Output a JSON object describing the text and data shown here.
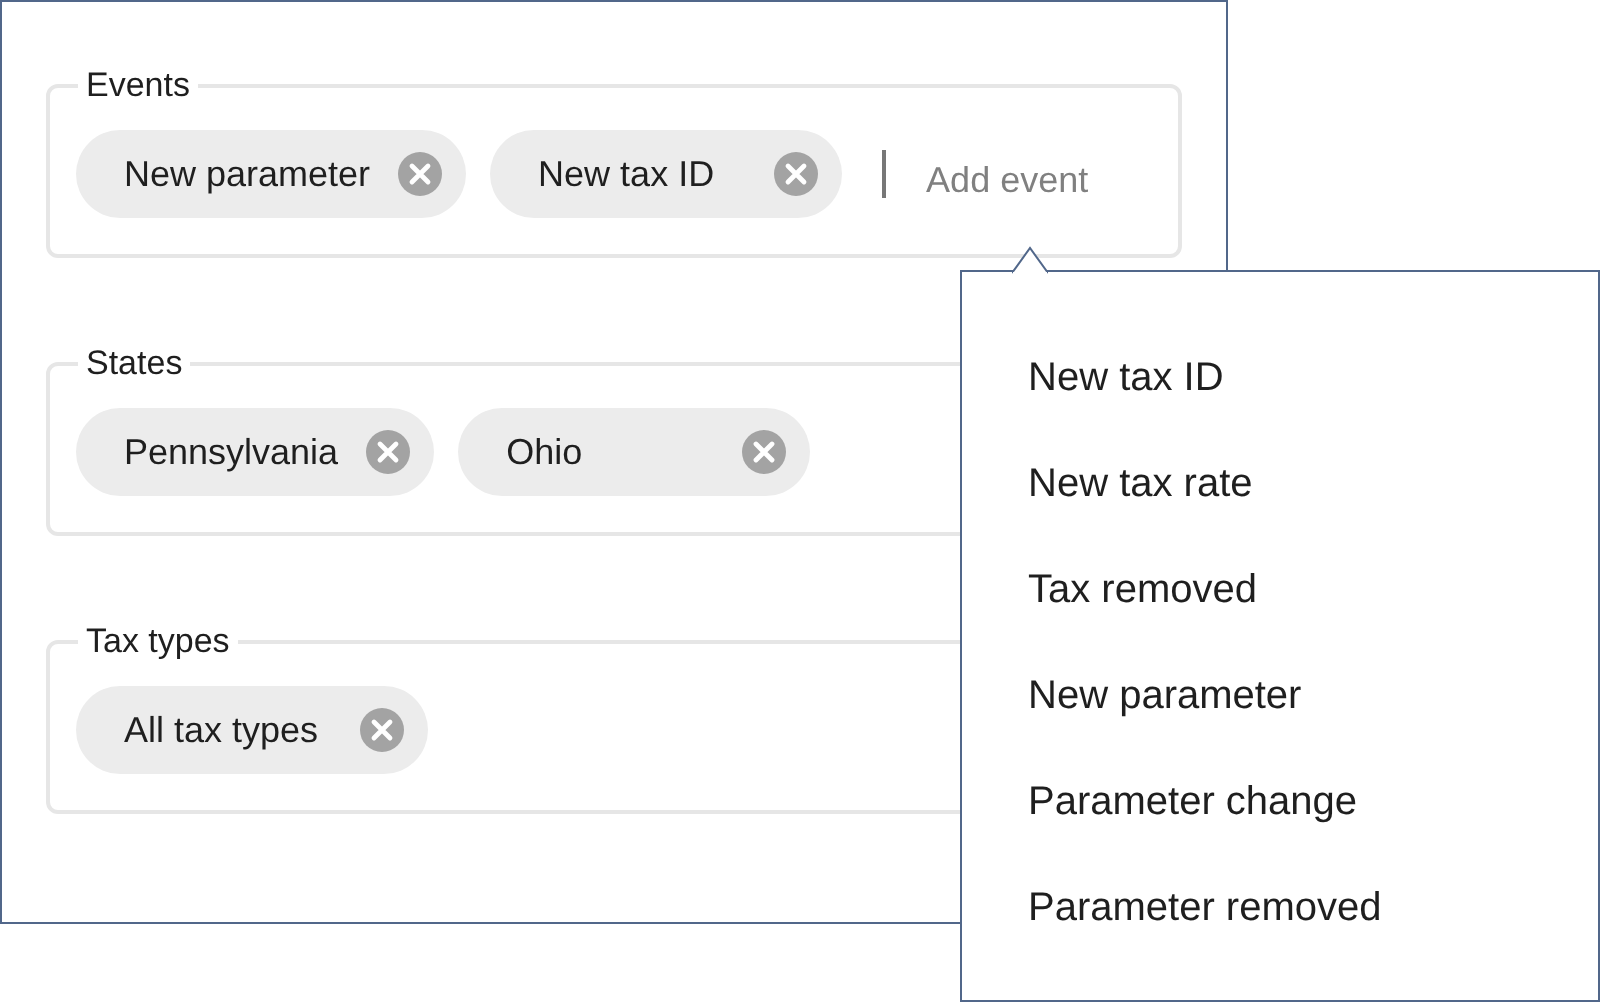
{
  "groups": [
    {
      "label": "Events",
      "chips": [
        "New parameter",
        "New tax ID"
      ],
      "add_placeholder": "Add event"
    },
    {
      "label": "States",
      "chips": [
        "Pennsylvania",
        "Ohio"
      ]
    },
    {
      "label": "Tax types",
      "chips": [
        "All tax types"
      ]
    }
  ],
  "dropdown": {
    "items": [
      "New tax ID",
      "New tax rate",
      "Tax removed",
      "New parameter",
      "Parameter change",
      "Parameter removed"
    ]
  }
}
